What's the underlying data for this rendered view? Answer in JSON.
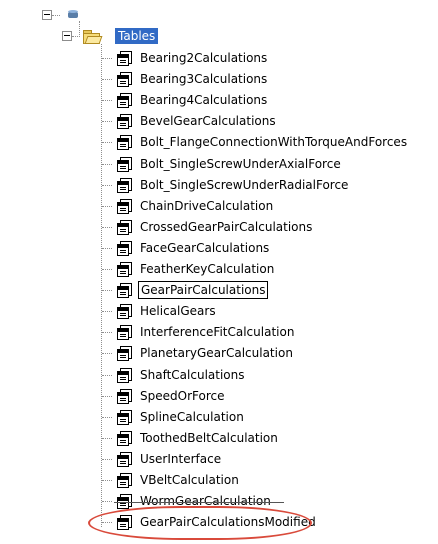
{
  "tree": {
    "root_expander_symbol": "−",
    "folder": {
      "label": "Tables"
    },
    "items": [
      {
        "label": "Bearing2Calculations"
      },
      {
        "label": "Bearing3Calculations"
      },
      {
        "label": "Bearing4Calculations"
      },
      {
        "label": "BevelGearCalculations"
      },
      {
        "label": "Bolt_FlangeConnectionWithTorqueAndForces"
      },
      {
        "label": "Bolt_SingleScrewUnderAxialForce"
      },
      {
        "label": "Bolt_SingleScrewUnderRadialForce"
      },
      {
        "label": "ChainDriveCalculation"
      },
      {
        "label": "CrossedGearPairCalculations"
      },
      {
        "label": "FaceGearCalculations"
      },
      {
        "label": "FeatherKeyCalculation"
      },
      {
        "label": "GearPairCalculations",
        "focused": true
      },
      {
        "label": "HelicalGears"
      },
      {
        "label": "InterferenceFitCalculation"
      },
      {
        "label": "PlanetaryGearCalculation"
      },
      {
        "label": "ShaftCalculations"
      },
      {
        "label": "SpeedOrForce"
      },
      {
        "label": "SplineCalculation"
      },
      {
        "label": "ToothedBeltCalculation"
      },
      {
        "label": "UserInterface"
      },
      {
        "label": "VBeltCalculation"
      },
      {
        "label": "WormGearCalculation",
        "struck": true
      },
      {
        "label": "GearPairCalculationsModified",
        "highlighted": true
      }
    ]
  },
  "colors": {
    "selection": "#316ac5",
    "callout": "#d94a3b"
  }
}
